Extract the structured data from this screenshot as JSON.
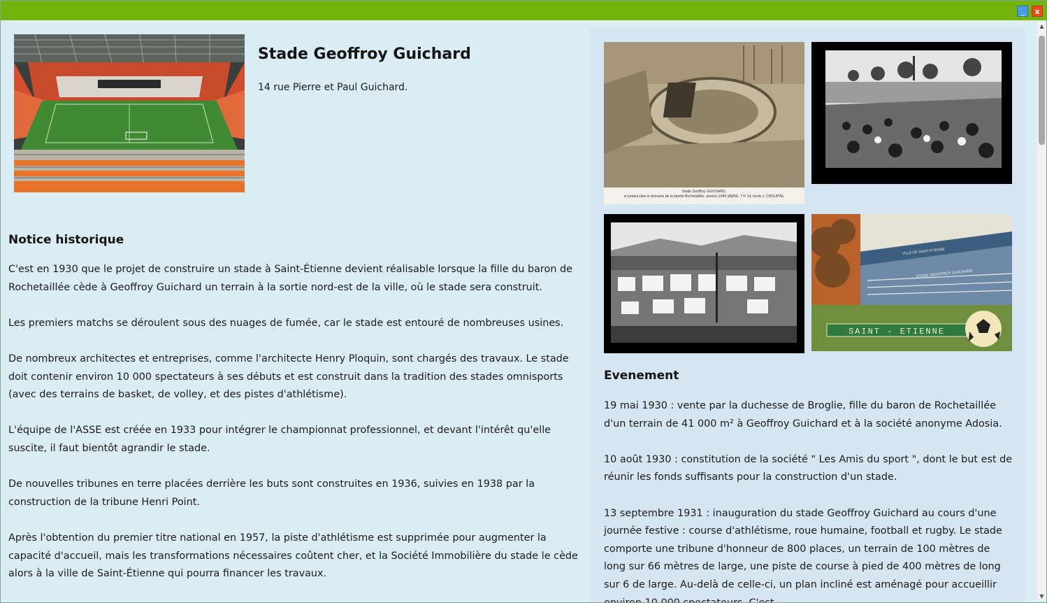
{
  "window": {
    "minimize_label": "_",
    "close_label": "x",
    "titlebar_color": "#72b30c"
  },
  "header": {
    "title": "Stade Geoffroy Guichard",
    "address": "14 rue Pierre et Paul Guichard."
  },
  "notice": {
    "heading": "Notice historique",
    "paragraphs": [
      "C'est en 1930 que le projet de construire un stade à Saint-Étienne devient réalisable lorsque la fille du baron de Rochetaillée cède à Geoffroy Guichard un terrain à la sortie nord-est de la ville, où le stade sera construit.",
      "Les premiers matchs se déroulent sous des nuages de fumée, car le stade est entouré de nombreuses usines.",
      "De nombreux architectes et entreprises, comme l'architecte Henry Ploquin, sont chargés des travaux. Le stade doit contenir environ 10 000 spectateurs à ses débuts et est construit dans la tradition des stades omnisports (avec des terrains de basket, de volley, et des pistes d'athlétisme).",
      "L'équipe de l'ASSE est créée en 1933 pour intégrer le championnat professionnel, et devant l'intérêt qu'elle suscite, il faut bientôt agrandir le stade.",
      "De nouvelles tribunes en terre placées derrière les buts sont construites en 1936, suivies en 1938 par la construction de la tribune Henri Point.",
      "Après l'obtention du premier titre national en 1957, la piste d'athlétisme est supprimée pour augmenter la capacité d'accueil, mais les transformations nécessaires coûtent cher, et la Société Immobilière du stade le cède alors à la ville de Saint-Étienne qui pourra financer les travaux."
    ]
  },
  "gallery": {
    "photo1_caption_line1": "Stade Geoffroy GUICHARD,",
    "photo1_caption_line2": "à l'arrière-plan le domaine de la famille Rochetaillée, années 1940 (AMSE, 7 Fi 14, fonds J. CHOUPIN).",
    "photo4_banner": "SAINT - ETIENNE",
    "photo4_sign": "STADE GEOFFROY GUICHARD",
    "photo4_sign_top": "VILLE DE SAINT-ETIENNE"
  },
  "events": {
    "heading": "Evenement",
    "paragraphs": [
      "19 mai 1930 : vente par la duchesse de Broglie, fille du baron de Rochetaillée d'un terrain de 41 000 m² à Geoffroy Guichard et à la société anonyme Adosia.",
      "10 août 1930 : constitution de la société \" Les Amis du sport \", dont le but est de réunir les fonds suffisants pour la construction d'un stade.",
      "13 septembre 1931 : inauguration du stade Geoffroy Guichard au cours d'une journée festive : course d'athlétisme, roue humaine, football et rugby. Le stade comporte une tribune d'honneur de 800 places, un terrain de 100 mètres de long sur 66 mètres de large, une piste de course à pied de 400 mètres de long sur 6 de large. Au-delà de celle-ci, un plan incliné est aménagé pour accueillir environ 10 000 spectateurs. C'est"
    ]
  },
  "scrollbar": {
    "up_icon": "▲",
    "down_icon": "▼",
    "scroll_position": 0.0
  }
}
